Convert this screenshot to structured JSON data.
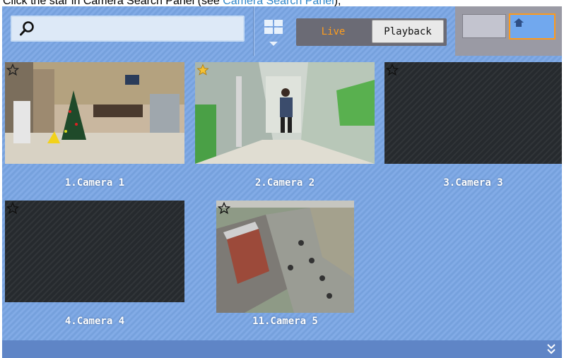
{
  "caption": {
    "text": "Click the star in Camera Search Panel (see ",
    "link": "Camera Search Panel",
    "suffix": ");"
  },
  "search": {
    "value": "",
    "placeholder": ""
  },
  "mode": {
    "live": "Live",
    "playback": "Playback",
    "active": "Live"
  },
  "colors": {
    "accent": "#ff9d1c",
    "panel": "#7aa6e4",
    "star_active": "#f5c233"
  },
  "cameras": [
    {
      "label": "1.Camera 1",
      "favorite": false,
      "has_video": true
    },
    {
      "label": "2.Camera 2",
      "favorite": true,
      "has_video": true
    },
    {
      "label": "3.Camera 3",
      "favorite": false,
      "has_video": false
    },
    {
      "label": "4.Camera 4",
      "favorite": false,
      "has_video": false
    },
    {
      "label": "11.Camera 5",
      "favorite": false,
      "has_video": true
    }
  ],
  "icons": {
    "search": "search-icon",
    "layout": "layout-grid-icon",
    "home": "home-icon",
    "expand": "double-chevron-down-icon",
    "favorite": "star-icon"
  }
}
